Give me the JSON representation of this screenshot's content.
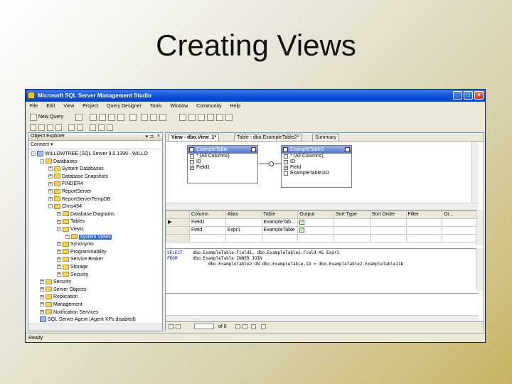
{
  "slide": {
    "title": "Creating Views"
  },
  "window": {
    "title": "Microsoft SQL Server Management Studio",
    "controls": {
      "minimize": "_",
      "maximize": "□",
      "close": "×"
    }
  },
  "menu": [
    "File",
    "Edit",
    "View",
    "Project",
    "Query Designer",
    "Tools",
    "Window",
    "Community",
    "Help"
  ],
  "toolbar": {
    "new_query": "New Query"
  },
  "object_explorer": {
    "header": "Object Explorer",
    "pin": "▾ ⊐",
    "close": "×",
    "connect": "Connect ▾",
    "tree": [
      {
        "label": "WILLOWTREE (SQL Server 9.0.1399 - WILLO",
        "level": 0,
        "exp": "-",
        "icon": "server"
      },
      {
        "label": "Databases",
        "level": 1,
        "exp": "-",
        "icon": "folder"
      },
      {
        "label": "System Databases",
        "level": 2,
        "exp": "+",
        "icon": "folder"
      },
      {
        "label": "Database Snapshots",
        "level": 2,
        "exp": "+",
        "icon": "folder"
      },
      {
        "label": "FINDER4",
        "level": 2,
        "exp": "+",
        "icon": "folder"
      },
      {
        "label": "ReportServer",
        "level": 2,
        "exp": "+",
        "icon": "folder"
      },
      {
        "label": "ReportServerTempDB",
        "level": 2,
        "exp": "+",
        "icon": "folder"
      },
      {
        "label": "Chris454",
        "level": 2,
        "exp": "-",
        "icon": "folder"
      },
      {
        "label": "Database Diagrams",
        "level": 3,
        "exp": "+",
        "icon": "folder"
      },
      {
        "label": "Tables",
        "level": 3,
        "exp": "+",
        "icon": "folder"
      },
      {
        "label": "Views",
        "level": 3,
        "exp": "-",
        "icon": "folder"
      },
      {
        "label": "System Views",
        "level": 4,
        "exp": "+",
        "icon": "folder",
        "selected": true
      },
      {
        "label": "Synonyms",
        "level": 3,
        "exp": "+",
        "icon": "folder"
      },
      {
        "label": "Programmability",
        "level": 3,
        "exp": "+",
        "icon": "folder"
      },
      {
        "label": "Service Broker",
        "level": 3,
        "exp": "+",
        "icon": "folder"
      },
      {
        "label": "Storage",
        "level": 3,
        "exp": "+",
        "icon": "folder"
      },
      {
        "label": "Security",
        "level": 3,
        "exp": "+",
        "icon": "folder"
      },
      {
        "label": "Security",
        "level": 1,
        "exp": "+",
        "icon": "folder"
      },
      {
        "label": "Server Objects",
        "level": 1,
        "exp": "+",
        "icon": "folder"
      },
      {
        "label": "Replication",
        "level": 1,
        "exp": "+",
        "icon": "folder"
      },
      {
        "label": "Management",
        "level": 1,
        "exp": "+",
        "icon": "folder"
      },
      {
        "label": "Notification Services",
        "level": 1,
        "exp": "+",
        "icon": "folder"
      },
      {
        "label": "SQL Server Agent (Agent XPs disabled)",
        "level": 1,
        "exp": "",
        "icon": "server"
      }
    ]
  },
  "tabs": [
    {
      "label": "View - dbo.View_1*",
      "active": true
    },
    {
      "label": "Table - dbo.ExampleTable2*",
      "active": false
    },
    {
      "label": "Summary",
      "active": false
    }
  ],
  "diagram": {
    "tables": [
      {
        "name": "ExampleTable",
        "columns": [
          {
            "label": "* (All Columns)",
            "checked": false
          },
          {
            "label": "ID",
            "checked": false
          },
          {
            "label": "Field1",
            "checked": true
          }
        ]
      },
      {
        "name": "ExampleTable2",
        "columns": [
          {
            "label": "* (All Columns)",
            "checked": false
          },
          {
            "label": "ID",
            "checked": false
          },
          {
            "label": "Field",
            "checked": true
          },
          {
            "label": "ExampleTable1ID",
            "checked": false
          }
        ]
      }
    ]
  },
  "grid": {
    "headers": [
      "Column",
      "Alias",
      "Table",
      "Output",
      "Sort Type",
      "Sort Order",
      "Filter",
      "Or..."
    ],
    "rows": [
      {
        "marker": "▶",
        "cells": [
          "Field1",
          "",
          "ExampleTab...",
          "✓",
          "",
          "",
          "",
          ""
        ]
      },
      {
        "marker": "",
        "cells": [
          "Field",
          "Expr1",
          "ExampleTable",
          "✓",
          "",
          "",
          "",
          ""
        ]
      },
      {
        "marker": "",
        "cells": [
          "",
          "",
          "",
          "",
          "",
          "",
          "",
          ""
        ]
      }
    ]
  },
  "sql": {
    "lines": [
      {
        "kw": "SELECT",
        "text": "    dbo.ExampleTable.Field1, dbo.ExampleTable2.Field AS Expr1"
      },
      {
        "kw": "FROM",
        "text": "      dbo.ExampleTable INNER JOIN"
      },
      {
        "kw": "",
        "text": "                dbo.ExampleTable2 ON dbo.ExampleTable.ID = dbo.ExampleTable2.ExampleTable1ID"
      }
    ]
  },
  "nav": {
    "of_label": "of 0"
  },
  "status": {
    "text": "Ready"
  }
}
